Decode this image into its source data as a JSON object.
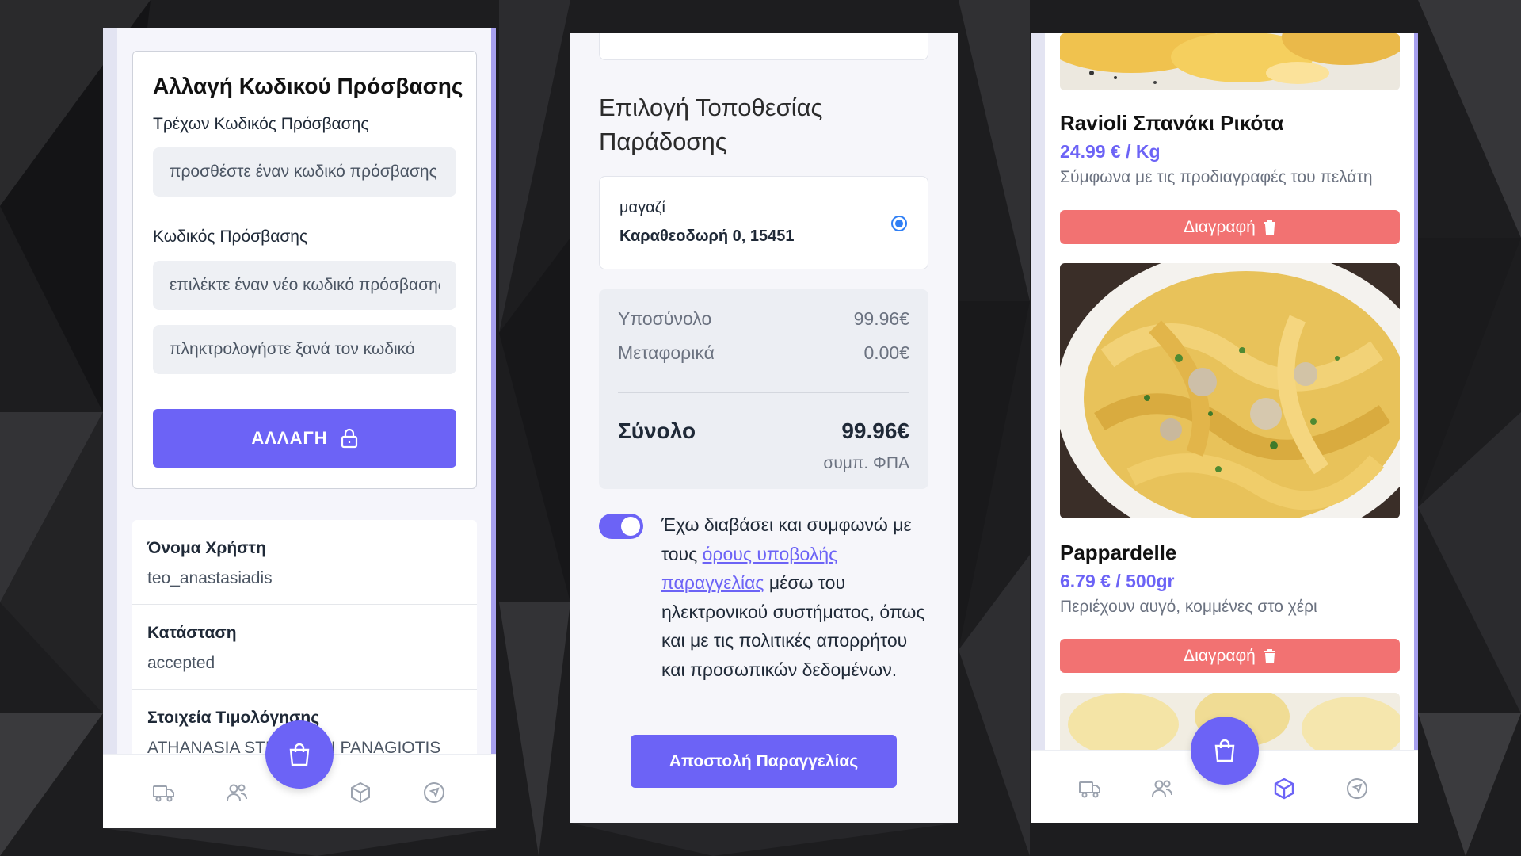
{
  "panel_account": {
    "password_card": {
      "title": "Αλλαγή Κωδικού Πρόσβασης",
      "current_label": "Τρέχων Κωδικός Πρόσβασης",
      "current_placeholder": "προσθέστε έναν κωδικό πρόσβασης",
      "new_label": "Κωδικός Πρόσβασης",
      "new_placeholder": "επιλέκτε έναν νέο κωδικό πρόσβασης",
      "repeat_placeholder": "πληκτρολογήστε ξανά τον κωδικό",
      "submit_label": "ΑΛΛΑΓΗ",
      "submit_icon": "lock-icon"
    },
    "info": [
      {
        "key": "Όνομα Χρήστη",
        "value": "teo_anastasiadis"
      },
      {
        "key": "Κατάσταση",
        "value": "accepted"
      },
      {
        "key": "Στοιχεία Τιμολόγησης",
        "value": "ATHANASIA STEFANAKI PANAGIOTIS"
      }
    ]
  },
  "panel_checkout": {
    "heading": "Επιλογή Τοποθεσίας Παράδοσης",
    "address": {
      "name": "μαγαζί",
      "line": "Καραθεοδωρή 0, 15451",
      "selected": true
    },
    "summary": {
      "subtotal_label": "Υποσύνολο",
      "subtotal_value": "99.96€",
      "shipping_label": "Μεταφορικά",
      "shipping_value": "0.00€",
      "total_label": "Σύνολο",
      "total_value": "99.96€",
      "vat_note": "συμπ. ΦΠΑ"
    },
    "terms": {
      "accepted": true,
      "text_before": "Έχω διαβάσει και συμφωνώ με τους ",
      "link_text": "όρους υποβολής παραγγελίας",
      "text_after": " μέσω του ηλεκτρονικού συστήματος, όπως και με τις πολιτικές απορρήτου και προσωπικών δεδομένων."
    },
    "submit_label": "Αποστολή Παραγγελίας"
  },
  "panel_products": {
    "products": [
      {
        "name": "Ravioli Σπανάκι Ρικότα",
        "price": "24.99 € / Kg",
        "note": "Σύμφωνα με τις προδιαγραφές του πελάτη",
        "delete_label": "Διαγραφή"
      },
      {
        "name": "Pappardelle",
        "price": "6.79 € / 500gr",
        "note": "Περιέχουν αυγό, κομμένες στο χέρι",
        "delete_label": "Διαγραφή"
      }
    ]
  },
  "nav_icons": [
    "truck-icon",
    "users-icon",
    "shopping-bag-icon",
    "package-icon",
    "navigation-icon"
  ],
  "colors": {
    "accent": "#6c63f6",
    "danger": "#f27272",
    "background": "#1c1c1e"
  }
}
